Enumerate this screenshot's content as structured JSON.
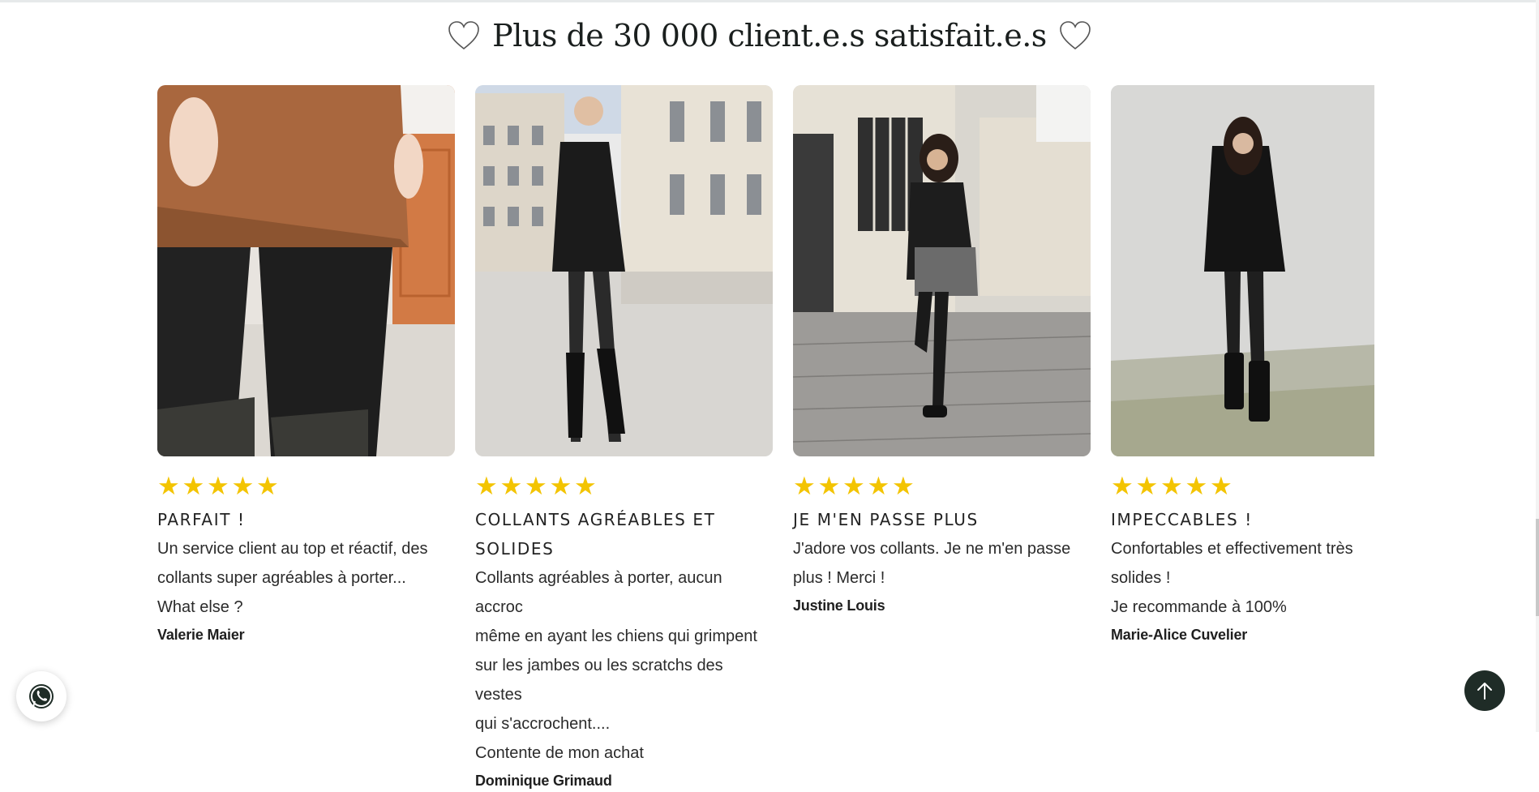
{
  "section": {
    "heading": "Plus de 30 000 client.e.s satisfait.e.s",
    "icons": [
      "heart-outline-icon",
      "heart-outline-icon"
    ]
  },
  "colors": {
    "stars": "#f3c400",
    "totop_bg": "#1f2c27"
  },
  "reviews": [
    {
      "rating": 5,
      "title": "PARFAIT !",
      "lines": [
        "Un service client au top et réactif, des",
        "collants super agréables à porter...",
        "What else ?"
      ],
      "author": "Valerie Maier"
    },
    {
      "rating": 5,
      "title_lines": [
        "COLLANTS AGRÉABLES ET",
        "SOLIDES"
      ],
      "lines": [
        "Collants agréables à porter, aucun accroc",
        "même en ayant les chiens qui grimpent",
        "sur les jambes ou les scratchs des vestes",
        "qui s'accrochent....",
        "Contente de mon achat"
      ],
      "author": "Dominique Grimaud"
    },
    {
      "rating": 5,
      "title": "JE M'EN PASSE PLUS",
      "lines": [
        "J'adore vos collants. Je ne m'en passe",
        "plus ! Merci !"
      ],
      "author": "Justine Louis"
    },
    {
      "rating": 5,
      "title": "IMPECCABLES !",
      "lines": [
        "Confortables et effectivement très",
        "solides !",
        "Je recommande à 100%"
      ],
      "author": "Marie-Alice Cuvelier"
    }
  ],
  "floating": {
    "whatsapp_icon": "whatsapp-icon",
    "totop_icon": "arrow-up-icon"
  }
}
